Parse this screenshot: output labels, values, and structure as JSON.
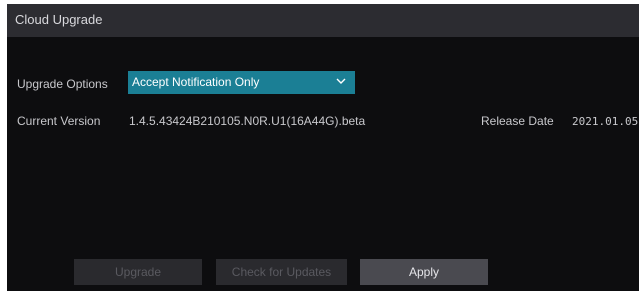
{
  "window": {
    "title": "Cloud Upgrade"
  },
  "upgrade_options": {
    "label": "Upgrade Options",
    "selected": "Accept Notification Only",
    "icon": "chevron-down-icon"
  },
  "current_version": {
    "label": "Current Version",
    "value": "1.4.5.43424B210105.N0R.U1(16A44G).beta"
  },
  "release_date": {
    "label": "Release Date",
    "value": "2021.01.05"
  },
  "buttons": {
    "upgrade": "Upgrade",
    "check_updates": "Check for Updates",
    "apply": "Apply"
  },
  "colors": {
    "accent": "#1b7f95",
    "background": "#0d0d0f",
    "titlebar": "#2c2c31"
  }
}
